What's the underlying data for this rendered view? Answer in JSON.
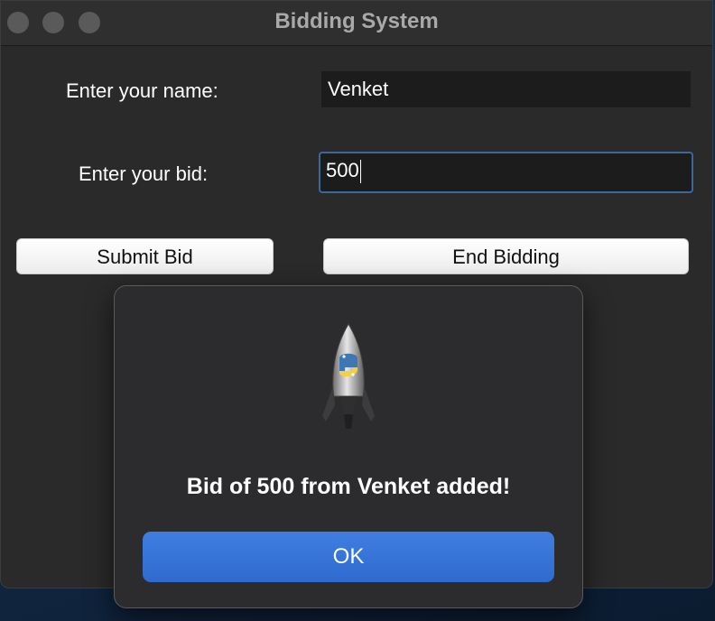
{
  "window": {
    "title": "Bidding System"
  },
  "form": {
    "name_label": "Enter your name:",
    "name_value": "Venket",
    "bid_label": "Enter your bid:",
    "bid_value": "500"
  },
  "buttons": {
    "submit": "Submit Bid",
    "end": "End Bidding"
  },
  "dialog": {
    "icon": "python-launcher-rocket-icon",
    "message": "Bid of 500 from Venket added!",
    "ok_label": "OK",
    "ok_color": "#3574db"
  }
}
